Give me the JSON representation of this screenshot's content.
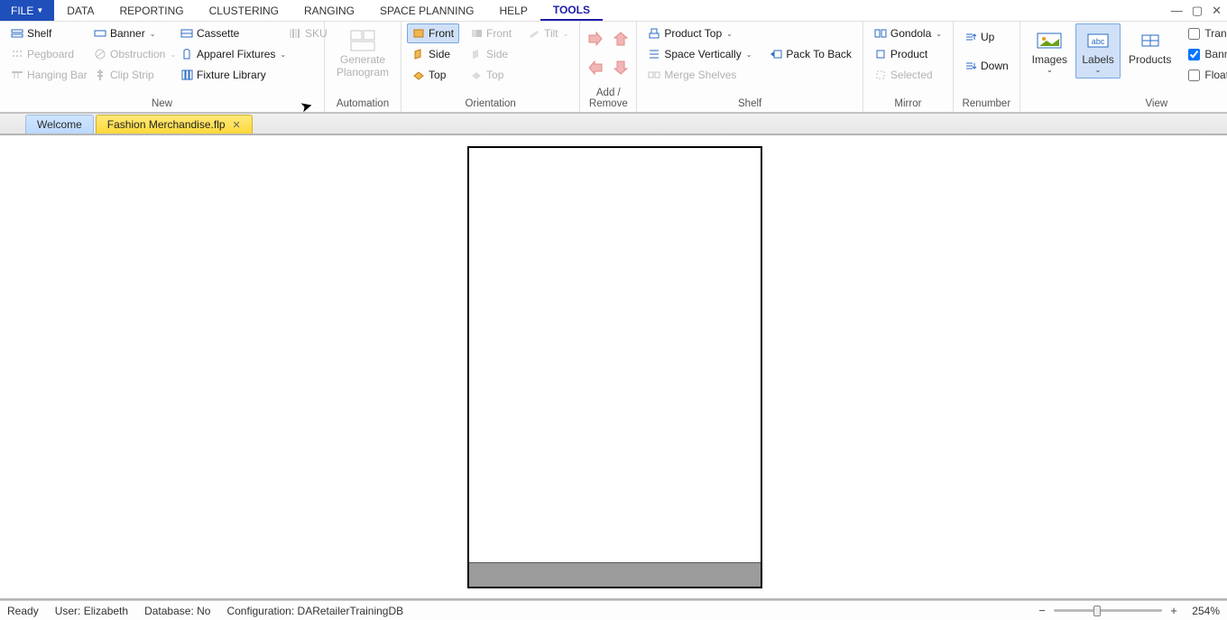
{
  "menu": {
    "file": "FILE",
    "items": [
      "DATA",
      "REPORTING",
      "CLUSTERING",
      "RANGING",
      "SPACE PLANNING",
      "HELP",
      "TOOLS"
    ],
    "active": "TOOLS"
  },
  "ribbon": {
    "groups": {
      "new": {
        "label": "New",
        "shelf": "Shelf",
        "pegboard": "Pegboard",
        "hanging_bar": "Hanging Bar",
        "banner": "Banner",
        "obstruction": "Obstruction",
        "clip_strip": "Clip Strip",
        "cassette": "Cassette",
        "apparel_fixtures": "Apparel Fixtures",
        "fixture_library": "Fixture Library",
        "sku": "SKU"
      },
      "automation": {
        "label": "Automation",
        "generate": "Generate",
        "planogram": "Planogram"
      },
      "orientation": {
        "label": "Orientation",
        "front": "Front",
        "side": "Side",
        "top": "Top",
        "front2": "Front",
        "side2": "Side",
        "top2": "Top",
        "tilt": "Tilt"
      },
      "addremove": {
        "label": "Add / Remove"
      },
      "shelf": {
        "label": "Shelf",
        "product_top": "Product Top",
        "space_vertically": "Space Vertically",
        "merge_shelves": "Merge Shelves",
        "pack_to_back": "Pack To Back"
      },
      "mirror": {
        "label": "Mirror",
        "gondola": "Gondola",
        "product": "Product",
        "selected": "Selected"
      },
      "renumber": {
        "label": "Renumber",
        "up": "Up",
        "down": "Down"
      },
      "view": {
        "label": "View",
        "images": "Images",
        "labels": "Labels",
        "products": "Products",
        "transparent": "Transparent Lab",
        "banners": "Banners",
        "floating": "Floating Status"
      }
    }
  },
  "tabs": {
    "welcome": "Welcome",
    "file": "Fashion Merchandise.flp"
  },
  "status": {
    "ready": "Ready",
    "user_label": "User:",
    "user_value": "Elizabeth",
    "db_label": "Database:",
    "db_value": "No",
    "config_label": "Configuration:",
    "config_value": "DARetailerTrainingDB",
    "zoom": "254%"
  }
}
